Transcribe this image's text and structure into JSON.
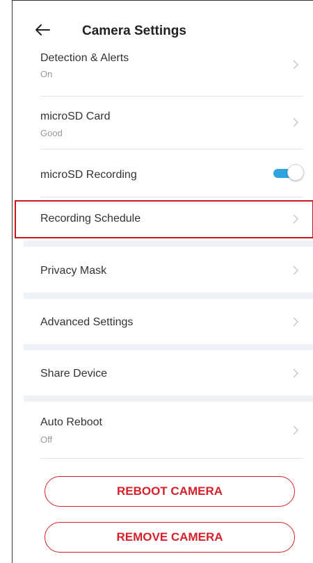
{
  "header": {
    "back_icon": "arrow-left-icon",
    "title": "Camera Settings"
  },
  "settings": {
    "detection": {
      "label": "Detection & Alerts",
      "status": "On"
    },
    "microsd_card": {
      "label": "microSD Card",
      "status": "Good"
    },
    "microsd_recording": {
      "label": "microSD Recording",
      "toggle_on": true
    },
    "recording_schedule": {
      "label": "Recording Schedule"
    },
    "privacy_mask": {
      "label": "Privacy Mask"
    },
    "advanced_settings": {
      "label": "Advanced Settings"
    },
    "share_device": {
      "label": "Share Device"
    },
    "auto_reboot": {
      "label": "Auto Reboot",
      "status": "Off"
    }
  },
  "buttons": {
    "reboot": "REBOOT CAMERA",
    "remove": "REMOVE CAMERA"
  },
  "colors": {
    "accent_blue": "#2ea3dd",
    "danger_red": "#d6202a",
    "highlight_red": "#c8161d",
    "section_gap": "#eef2f6"
  }
}
